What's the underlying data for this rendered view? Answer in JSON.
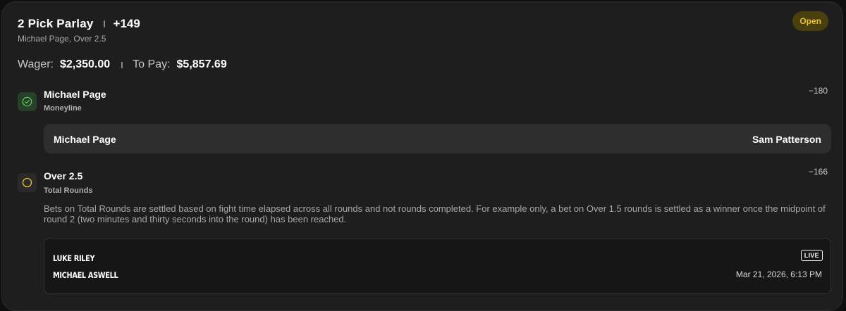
{
  "bet": {
    "title": "2 Pick Parlay",
    "odds": "+149",
    "summary": "Michael Page, Over 2.5",
    "status": "Open",
    "wager_label": "Wager:",
    "wager_value": "$2,350.00",
    "payout_label": "To Pay:",
    "payout_value": "$5,857.69"
  },
  "legs": [
    {
      "selection": "Michael Page",
      "market": "Moneyline",
      "odds": "−180",
      "status": "won",
      "matchup": {
        "home": "Michael Page",
        "away": "Sam Patterson"
      }
    },
    {
      "selection": "Over 2.5",
      "market": "Total Rounds",
      "odds": "−166",
      "status": "pending",
      "description": "Bets on Total Rounds are settled based on fight time elapsed across all rounds and not rounds completed. For example only, a bet on Over 1.5 rounds is settled as a winner once the midpoint of round 2 (two minutes and thirty seconds into the round) has been reached.",
      "event": {
        "fighter_1": "LUKE RILEY",
        "fighter_2": "MICHAEL ASWELL",
        "badge": "LIVE",
        "datetime": "Mar 21, 2026, 6:13 PM"
      }
    }
  ],
  "colors": {
    "status_open": "#e8c22e",
    "won_green": "#5fcf5a",
    "pending_yellow": "#e8c22e"
  },
  "icons": {
    "leg_won": "check-circle-icon",
    "leg_pending": "pending-circle-icon"
  }
}
